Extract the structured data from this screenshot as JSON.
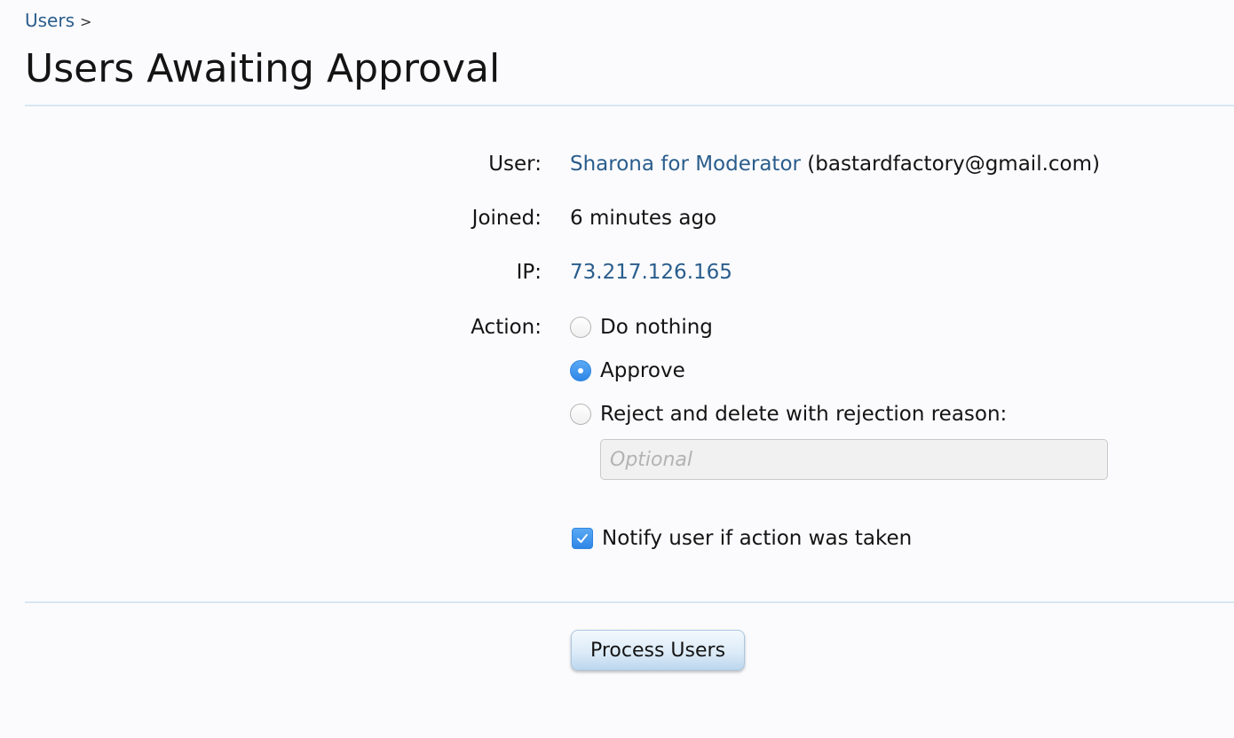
{
  "breadcrumb": {
    "link_label": "Users",
    "separator": ">"
  },
  "page": {
    "title": "Users Awaiting Approval"
  },
  "user_record": {
    "user_label": "User:",
    "username": "Sharona for Moderator",
    "email": "(bastardfactory@gmail.com)",
    "joined_label": "Joined:",
    "joined_value": "6 minutes ago",
    "ip_label": "IP:",
    "ip_value": "73.217.126.165",
    "action_label": "Action:"
  },
  "actions": {
    "do_nothing": "Do nothing",
    "approve": "Approve",
    "reject": "Reject and delete with rejection reason:",
    "selected": "approve"
  },
  "reason": {
    "placeholder": "Optional",
    "value": ""
  },
  "notify": {
    "label": "Notify user if action was taken",
    "checked": true
  },
  "submit": {
    "label": "Process Users"
  },
  "colors": {
    "link": "#2a5d8c",
    "accent": "#2e86e6",
    "divider": "#d7e7f2"
  }
}
